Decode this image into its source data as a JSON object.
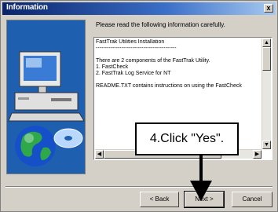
{
  "window": {
    "title": "Information",
    "close_glyph": "x"
  },
  "instruction": "Please read the following information carefully.",
  "readme": {
    "lines": [
      "FastTrak Utilities Installation",
      "--------------------------------------------",
      "",
      "There are 2 components of the FastTrak Utility.",
      "1. FastCheck",
      "2. FastTrak Log Service for NT",
      "",
      "README.TXT contains instructions on using the FastCheck"
    ]
  },
  "callout": {
    "text": "4.Click \"Yes\"."
  },
  "buttons": {
    "back": "< Back",
    "next": "Next >",
    "cancel": "Cancel"
  },
  "colors": {
    "titlebar": "#0a246a",
    "face": "#d4d0c8",
    "illustration_bg": "#1f5fb0"
  }
}
